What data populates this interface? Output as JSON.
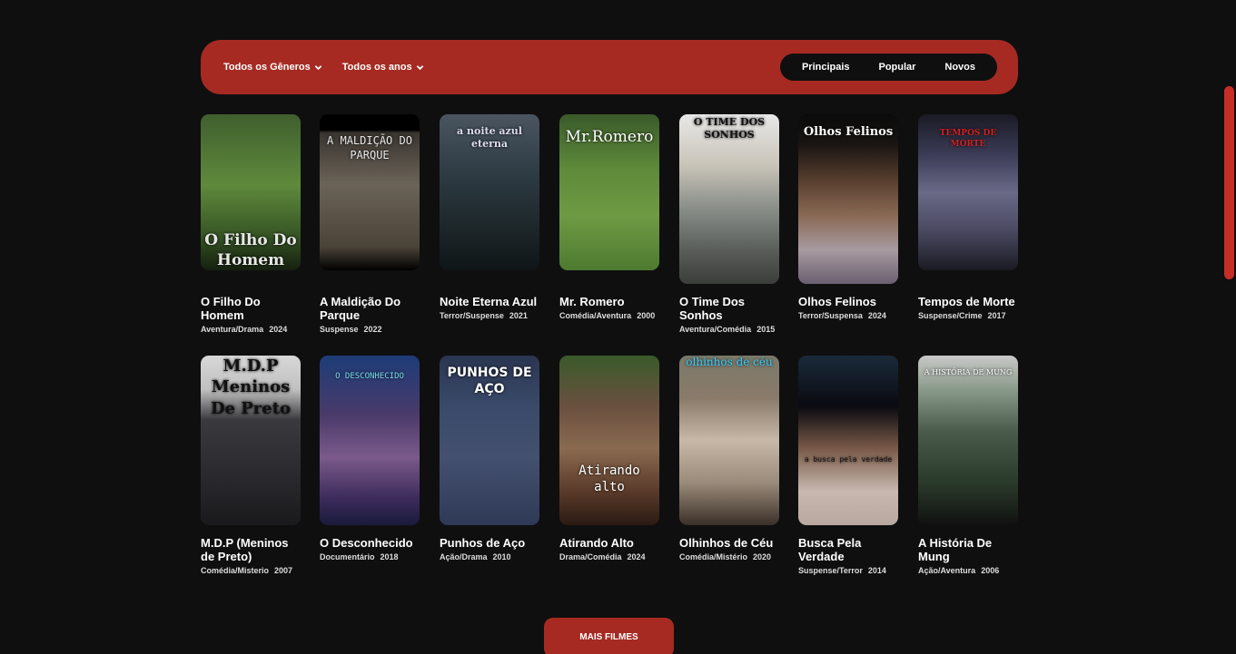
{
  "filters": {
    "genre_label": "Todos os Gêneros",
    "year_label": "Todos os anos",
    "sort_options": [
      "Principais",
      "Popular",
      "Novos"
    ]
  },
  "movies": [
    {
      "title": "O Filho Do Homem",
      "genre": "Aventura/Drama",
      "year": "2024",
      "poster_text": "O Filho Do Homem"
    },
    {
      "title": "A Maldição Do Parque",
      "genre": "Suspense",
      "year": "2022",
      "poster_text": "A MALDIÇÃO DO PARQUE"
    },
    {
      "title": "Noite Eterna Azul",
      "genre": "Terror/Suspense",
      "year": "2021",
      "poster_text": "a noite azul eterna"
    },
    {
      "title": "Mr. Romero",
      "genre": "Comédia/Aventura",
      "year": "2000",
      "poster_text": "Mr.Romero"
    },
    {
      "title": "O Time Dos Sonhos",
      "genre": "Aventura/Comédia",
      "year": "2015",
      "poster_text": "O TIME DOS SONHOS"
    },
    {
      "title": "Olhos Felinos",
      "genre": "Terror/Suspensa",
      "year": "2024",
      "poster_text": "Olhos Felinos"
    },
    {
      "title": "Tempos de Morte",
      "genre": "Suspense/Crime",
      "year": "2017",
      "poster_text": "TEMPOS DE MORTE"
    },
    {
      "title": "M.D.P (Meninos de Preto)",
      "genre": "Comédia/Misterio",
      "year": "2007",
      "poster_text": "M.D.P Meninos De Preto"
    },
    {
      "title": "O Desconhecido",
      "genre": "Documentário",
      "year": "2018",
      "poster_text": "O DESCONHECIDO"
    },
    {
      "title": "Punhos de Aço",
      "genre": "Ação/Drama",
      "year": "2010",
      "poster_text": "PUNHOS DE AÇO"
    },
    {
      "title": "Atirando Alto",
      "genre": "Drama/Comédia",
      "year": "2024",
      "poster_text": "Atirando alto"
    },
    {
      "title": "Olhinhos de Céu",
      "genre": "Comédia/Mistério",
      "year": "2020",
      "poster_text": "olhinhos de céu"
    },
    {
      "title": "Busca Pela Verdade",
      "genre": "Suspense/Terror",
      "year": "2014",
      "poster_text": "a busca pela verdade"
    },
    {
      "title": "A História De Mung",
      "genre": "Ação/Aventura",
      "year": "2006",
      "poster_text": "A HISTÓRIA DE MUNG"
    }
  ],
  "more_button": "MAIS FILMES",
  "colors": {
    "accent": "#a62a22",
    "background": "#0f0f10",
    "sort_bg": "#0f0f10"
  }
}
